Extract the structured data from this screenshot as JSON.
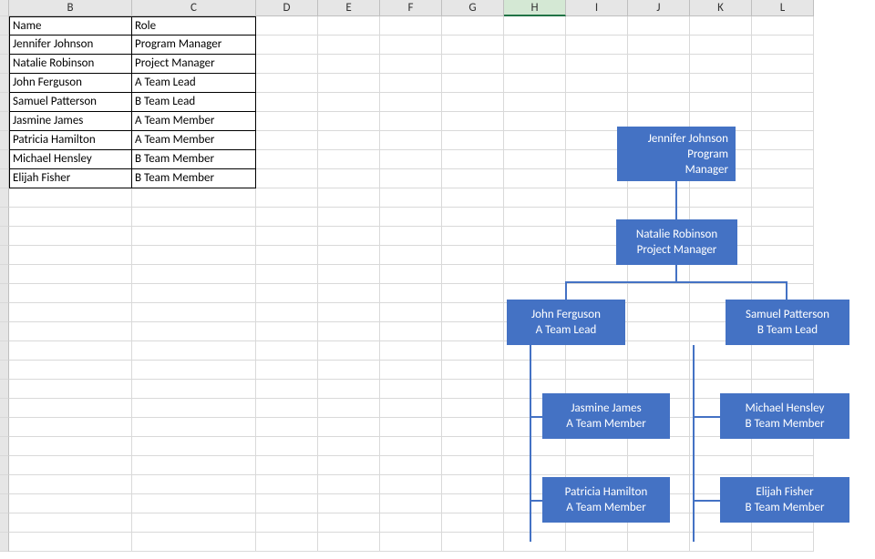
{
  "columns": [
    {
      "letter": "",
      "w": "w-rowh"
    },
    {
      "letter": "B",
      "w": "w-B"
    },
    {
      "letter": "C",
      "w": "w-C"
    },
    {
      "letter": "D",
      "w": "w-std"
    },
    {
      "letter": "E",
      "w": "w-std"
    },
    {
      "letter": "F",
      "w": "w-std"
    },
    {
      "letter": "G",
      "w": "w-std"
    },
    {
      "letter": "H",
      "w": "w-std",
      "selected": true
    },
    {
      "letter": "I",
      "w": "w-std"
    },
    {
      "letter": "J",
      "w": "w-std"
    },
    {
      "letter": "K",
      "w": "w-std"
    },
    {
      "letter": "L",
      "w": "w-std"
    }
  ],
  "table": {
    "header": {
      "name": "Name",
      "role": "Role"
    },
    "rows": [
      {
        "name": "Jennifer Johnson",
        "role": "Program Manager"
      },
      {
        "name": "Natalie Robinson",
        "role": "Project Manager"
      },
      {
        "name": "John Ferguson",
        "role": "A Team Lead"
      },
      {
        "name": "Samuel Patterson",
        "role": "B Team Lead"
      },
      {
        "name": "Jasmine James",
        "role": "A Team Member"
      },
      {
        "name": "Patricia Hamilton",
        "role": "A Team Member"
      },
      {
        "name": "Michael Hensley",
        "role": "B Team Member"
      },
      {
        "name": "Elijah Fisher",
        "role": "B Team Member"
      }
    ]
  },
  "org": {
    "node1": {
      "l1": "Jennifer Johnson",
      "l2": "Program",
      "l3": "Manager"
    },
    "node2": {
      "l1": "Natalie Robinson",
      "l2": "Project Manager"
    },
    "nodeA": {
      "l1": "John Ferguson",
      "l2": "A Team Lead"
    },
    "nodeB": {
      "l1": "Samuel Patterson",
      "l2": "B Team Lead"
    },
    "nodeA1": {
      "l1": "Jasmine James",
      "l2": "A Team Member"
    },
    "nodeA2": {
      "l1": "Patricia Hamilton",
      "l2": "A Team Member"
    },
    "nodeB1": {
      "l1": "Michael Hensley",
      "l2": "B Team Member"
    },
    "nodeB2": {
      "l1": "Elijah Fisher",
      "l2": "B Team Member"
    }
  },
  "chart_data": {
    "type": "orgchart",
    "title": "",
    "tree": {
      "name": "Jennifer Johnson",
      "role": "Program Manager",
      "children": [
        {
          "name": "Natalie Robinson",
          "role": "Project Manager",
          "children": [
            {
              "name": "John Ferguson",
              "role": "A Team Lead",
              "children": [
                {
                  "name": "Jasmine James",
                  "role": "A Team Member"
                },
                {
                  "name": "Patricia Hamilton",
                  "role": "A Team Member"
                }
              ]
            },
            {
              "name": "Samuel Patterson",
              "role": "B Team Lead",
              "children": [
                {
                  "name": "Michael Hensley",
                  "role": "B Team Member"
                },
                {
                  "name": "Elijah Fisher",
                  "role": "B Team Member"
                }
              ]
            }
          ]
        }
      ]
    }
  }
}
